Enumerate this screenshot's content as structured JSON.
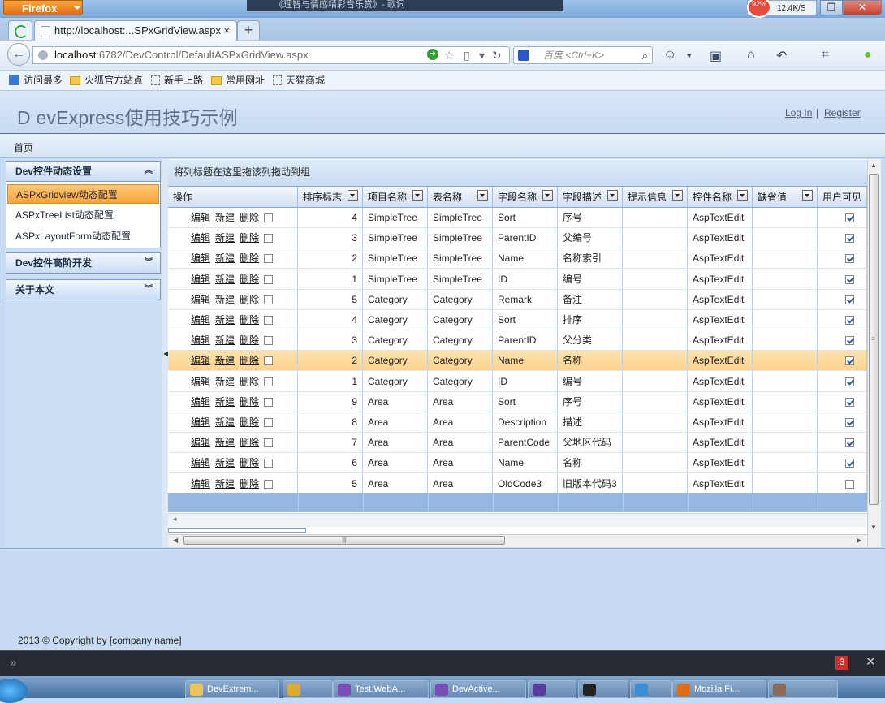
{
  "browser": {
    "app_button": "Firefox",
    "media_title": "《理智与情感精彩音乐赏》- 歌词",
    "speed": {
      "ring": "92%",
      "text": "12.4K/S"
    },
    "tab_title": "http://localhost:...SPxGridView.aspx",
    "tab_close": "×",
    "new_tab": "+",
    "url_host": "localhost",
    "url_path": ":6782/DevControl/DefaultASPxGridView.aspx",
    "search_placeholder": "百度 <Ctrl+K>",
    "bookmarks": [
      "访问最多",
      "火狐官方站点",
      "新手上路",
      "常用网址",
      "天猫商城"
    ]
  },
  "page": {
    "site_title": "D evExpress使用技巧示例",
    "login_label": "Log In",
    "separator": "|",
    "register_label": "Register",
    "menu_home": "首页",
    "copyright": "2013 © Copyright by [company name]"
  },
  "sidebar": {
    "group1": "Dev控件动态设置",
    "group1_items": [
      "ASPxGridview动态配置",
      "ASPxTreeList动态配置",
      "ASPxLayoutForm动态配置"
    ],
    "group2": "Dev控件高阶开发",
    "group3": "关于本文"
  },
  "grid": {
    "group_panel_text": "将列标题在这里拖该列拖动到组",
    "columns": [
      "操作",
      "排序标志",
      "项目名称",
      "表名称",
      "字段名称",
      "字段描述",
      "提示信息",
      "控件名称",
      "缺省值",
      "用户可见"
    ],
    "commands": {
      "edit": "编辑",
      "new": "新建",
      "delete": "删除"
    },
    "selected_row_index": 7,
    "rows": [
      {
        "sort": "4",
        "project": "SimpleTree",
        "table": "SimpleTree",
        "field": "Sort",
        "desc": "序号",
        "hint": "",
        "control": "AspTextEdit",
        "default": "",
        "visible": true
      },
      {
        "sort": "3",
        "project": "SimpleTree",
        "table": "SimpleTree",
        "field": "ParentID",
        "desc": "父编号",
        "hint": "",
        "control": "AspTextEdit",
        "default": "",
        "visible": true
      },
      {
        "sort": "2",
        "project": "SimpleTree",
        "table": "SimpleTree",
        "field": "Name",
        "desc": "名称索引",
        "hint": "",
        "control": "AspTextEdit",
        "default": "",
        "visible": true
      },
      {
        "sort": "1",
        "project": "SimpleTree",
        "table": "SimpleTree",
        "field": "ID",
        "desc": "编号",
        "hint": "",
        "control": "AspTextEdit",
        "default": "",
        "visible": true
      },
      {
        "sort": "5",
        "project": "Category",
        "table": "Category",
        "field": "Remark",
        "desc": "备注",
        "hint": "",
        "control": "AspTextEdit",
        "default": "",
        "visible": true
      },
      {
        "sort": "4",
        "project": "Category",
        "table": "Category",
        "field": "Sort",
        "desc": "排序",
        "hint": "",
        "control": "AspTextEdit",
        "default": "",
        "visible": true
      },
      {
        "sort": "3",
        "project": "Category",
        "table": "Category",
        "field": "ParentID",
        "desc": "父分类",
        "hint": "",
        "control": "AspTextEdit",
        "default": "",
        "visible": true
      },
      {
        "sort": "2",
        "project": "Category",
        "table": "Category",
        "field": "Name",
        "desc": "名称",
        "hint": "",
        "control": "AspTextEdit",
        "default": "",
        "visible": true
      },
      {
        "sort": "1",
        "project": "Category",
        "table": "Category",
        "field": "ID",
        "desc": "编号",
        "hint": "",
        "control": "AspTextEdit",
        "default": "",
        "visible": true
      },
      {
        "sort": "9",
        "project": "Area",
        "table": "Area",
        "field": "Sort",
        "desc": "序号",
        "hint": "",
        "control": "AspTextEdit",
        "default": "",
        "visible": true
      },
      {
        "sort": "8",
        "project": "Area",
        "table": "Area",
        "field": "Description",
        "desc": "描述",
        "hint": "",
        "control": "AspTextEdit",
        "default": "",
        "visible": true
      },
      {
        "sort": "7",
        "project": "Area",
        "table": "Area",
        "field": "ParentCode",
        "desc": "父地区代码",
        "hint": "",
        "control": "AspTextEdit",
        "default": "",
        "visible": true
      },
      {
        "sort": "6",
        "project": "Area",
        "table": "Area",
        "field": "Name",
        "desc": "名称",
        "hint": "",
        "control": "AspTextEdit",
        "default": "",
        "visible": true
      },
      {
        "sort": "5",
        "project": "Area",
        "table": "Area",
        "field": "OldCode3",
        "desc": "旧版本代码3",
        "hint": "",
        "control": "AspTextEdit",
        "default": "",
        "visible": false
      }
    ]
  },
  "devbar": {
    "error_count": "3"
  },
  "taskbar": {
    "items": [
      {
        "label": "DevExtrem...",
        "color": "#e8c45a"
      },
      {
        "label": "",
        "color": "#e0a830"
      },
      {
        "label": "Test.WebA...",
        "color": "#7a4fb5"
      },
      {
        "label": "DevActive...",
        "color": "#7a4fb5"
      },
      {
        "label": "",
        "color": "#5a3a9a"
      },
      {
        "label": "",
        "color": "#222222"
      },
      {
        "label": "",
        "color": "#3a8fd8"
      },
      {
        "label": "Mozilla Fi...",
        "color": "#e06d10"
      },
      {
        "label": "",
        "color": "#8a6a5a"
      }
    ]
  }
}
